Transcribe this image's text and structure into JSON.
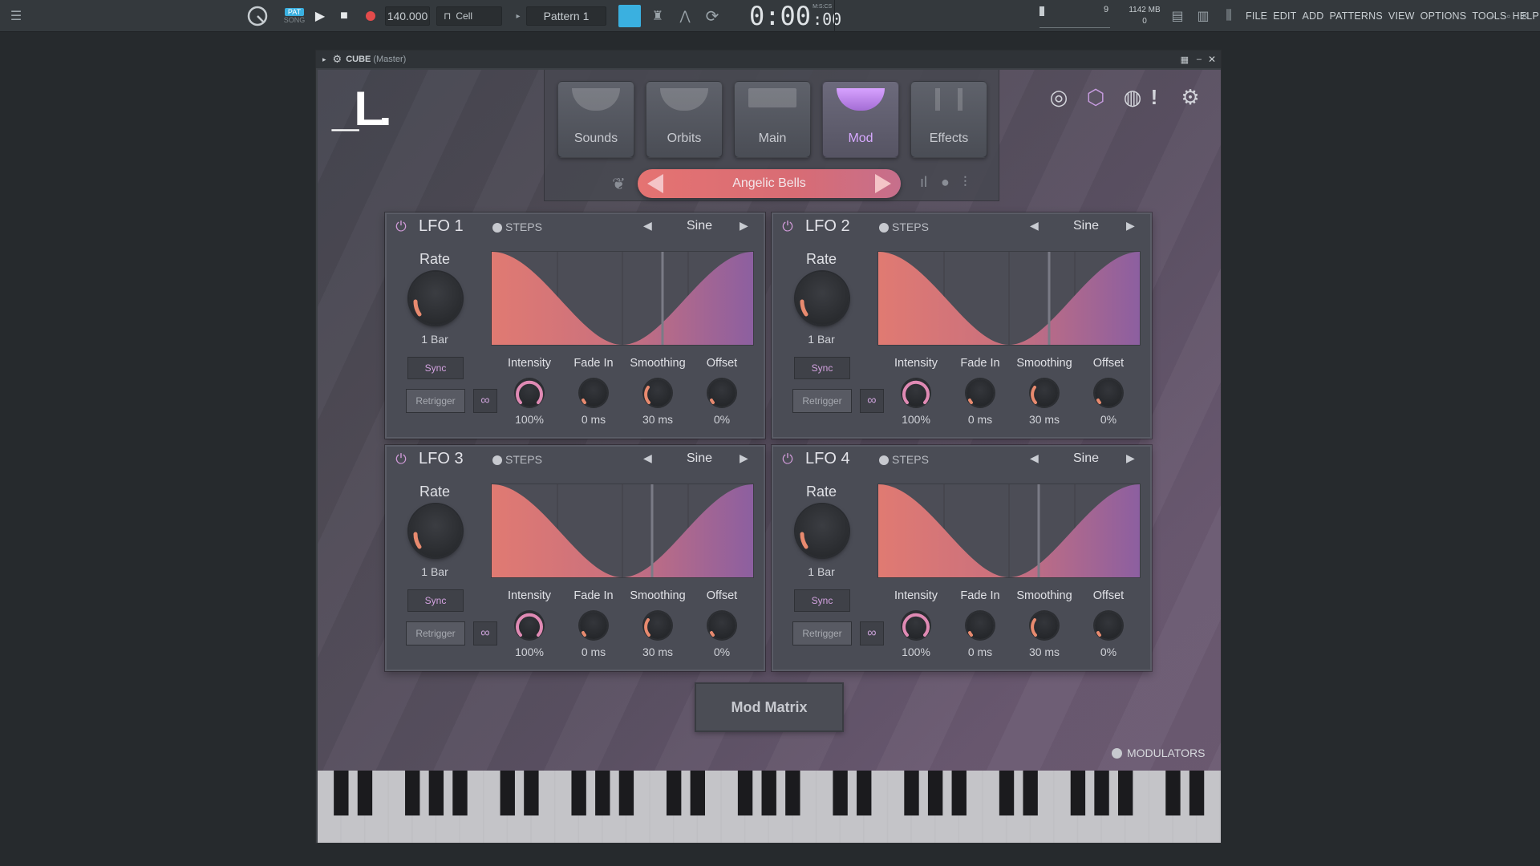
{
  "topbar": {
    "pat_label": "PAT",
    "song_label": "SONG",
    "tempo": "140.000",
    "snap": "Cell",
    "pattern": "Pattern 1",
    "time": "0:00",
    "time_sub": ":00",
    "time_units": "M:S:CS",
    "cpu_number": "9",
    "memory": "1142 MB",
    "voices": "0",
    "menus": [
      "FILE",
      "EDIT",
      "ADD",
      "PATTERNS",
      "VIEW",
      "OPTIONS",
      "TOOLS",
      "HELP"
    ]
  },
  "window": {
    "title": "CUBE",
    "subtitle": "(Master)"
  },
  "plugin": {
    "logo": "_L.",
    "tabs": [
      {
        "label": "Sounds"
      },
      {
        "label": "Orbits"
      },
      {
        "label": "Main"
      },
      {
        "label": "Mod",
        "active": true
      },
      {
        "label": "Effects"
      }
    ],
    "preset": "Angelic Bells",
    "accent": "#d7a2ff",
    "lfos": [
      {
        "title": "LFO 1",
        "steps": "STEPS",
        "wave": "Sine",
        "rate_label": "Rate",
        "rate_value": "1 Bar",
        "sync": "Sync",
        "retrigger": "Retrigger",
        "params": [
          {
            "label": "Intensity",
            "value": "100%"
          },
          {
            "label": "Fade In",
            "value": "0 ms"
          },
          {
            "label": "Smoothing",
            "value": "30 ms"
          },
          {
            "label": "Offset",
            "value": "0%"
          }
        ]
      },
      {
        "title": "LFO 2",
        "steps": "STEPS",
        "wave": "Sine",
        "rate_label": "Rate",
        "rate_value": "1 Bar",
        "sync": "Sync",
        "retrigger": "Retrigger",
        "params": [
          {
            "label": "Intensity",
            "value": "100%"
          },
          {
            "label": "Fade In",
            "value": "0 ms"
          },
          {
            "label": "Smoothing",
            "value": "30 ms"
          },
          {
            "label": "Offset",
            "value": "0%"
          }
        ]
      },
      {
        "title": "LFO 3",
        "steps": "STEPS",
        "wave": "Sine",
        "rate_label": "Rate",
        "rate_value": "1 Bar",
        "sync": "Sync",
        "retrigger": "Retrigger",
        "params": [
          {
            "label": "Intensity",
            "value": "100%"
          },
          {
            "label": "Fade In",
            "value": "0 ms"
          },
          {
            "label": "Smoothing",
            "value": "30 ms"
          },
          {
            "label": "Offset",
            "value": "0%"
          }
        ]
      },
      {
        "title": "LFO 4",
        "steps": "STEPS",
        "wave": "Sine",
        "rate_label": "Rate",
        "rate_value": "1 Bar",
        "sync": "Sync",
        "retrigger": "Retrigger",
        "params": [
          {
            "label": "Intensity",
            "value": "100%"
          },
          {
            "label": "Fade In",
            "value": "0 ms"
          },
          {
            "label": "Smoothing",
            "value": "30 ms"
          },
          {
            "label": "Offset",
            "value": "0%"
          }
        ]
      }
    ],
    "mod_matrix": "Mod Matrix",
    "modulators": "MODULATORS"
  }
}
